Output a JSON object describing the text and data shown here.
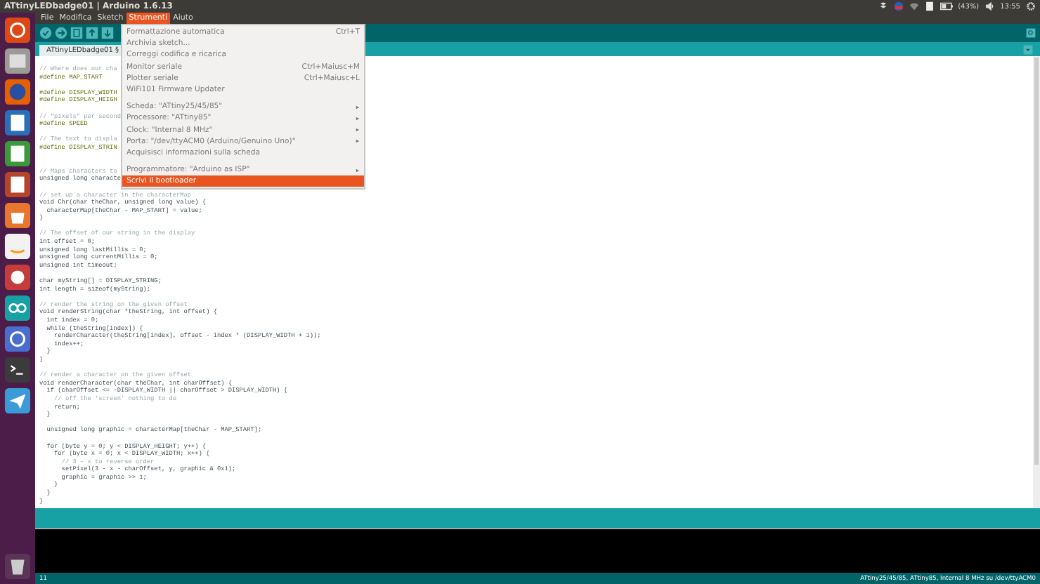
{
  "window": {
    "title": "ATtinyLEDbadge01 | Arduino 1.6.13"
  },
  "top_panel": {
    "battery": "(43%)",
    "clock": "13:55"
  },
  "menu_bar": [
    {
      "label": "File",
      "selected": false
    },
    {
      "label": "Modifica",
      "selected": false
    },
    {
      "label": "Sketch",
      "selected": false
    },
    {
      "label": "Strumenti",
      "selected": true
    },
    {
      "label": "Aiuto",
      "selected": false
    }
  ],
  "open_menu": {
    "items": [
      {
        "kind": "item",
        "label": "Formattazione automatica",
        "shortcut": "Ctrl+T",
        "selected": false
      },
      {
        "kind": "item",
        "label": "Archivia sketch...",
        "selected": false
      },
      {
        "kind": "item",
        "label": "Correggi codifica e ricarica",
        "selected": false
      },
      {
        "kind": "item",
        "label": "Monitor seriale",
        "shortcut": "Ctrl+Maiusc+M",
        "selected": false
      },
      {
        "kind": "item",
        "label": "Plotter seriale",
        "shortcut": "Ctrl+Maiusc+L",
        "selected": false
      },
      {
        "kind": "item",
        "label": "WiFi101 Firmware Updater",
        "selected": false
      },
      {
        "kind": "separator"
      },
      {
        "kind": "submenu",
        "label": "Scheda: \"ATtiny25/45/85\"",
        "selected": false
      },
      {
        "kind": "submenu",
        "label": "Processore: \"ATtiny85\"",
        "selected": false
      },
      {
        "kind": "submenu",
        "label": "Clock: \"Internal 8 MHz\"",
        "selected": false
      },
      {
        "kind": "submenu",
        "label": "Porta: \"/dev/ttyACM0 (Arduino/Genuino Uno)\"",
        "selected": false
      },
      {
        "kind": "item",
        "label": "Acquisisci informazioni sulla scheda",
        "selected": false
      },
      {
        "kind": "separator"
      },
      {
        "kind": "submenu",
        "label": "Programmatore: \"Arduino as ISP\"",
        "selected": false
      },
      {
        "kind": "item",
        "label": "Scrivi il bootloader",
        "selected": true
      }
    ]
  },
  "tabs": [
    {
      "label": "ATtinyLEDbadge01 §",
      "selected": true
    }
  ],
  "code": [
    {
      "kind": "comment",
      "text": "// Where does our cha"
    },
    {
      "kind": "directive",
      "text": "#define MAP_START"
    },
    {
      "kind": "blank"
    },
    {
      "kind": "directive",
      "text": "#define DISPLAY_WIDTH"
    },
    {
      "kind": "directive",
      "text": "#define DISPLAY_HEIGH"
    },
    {
      "kind": "blank"
    },
    {
      "kind": "comment",
      "text": "// \"pixels\" per second"
    },
    {
      "kind": "directive",
      "text": "#define SPEED"
    },
    {
      "kind": "blank"
    },
    {
      "kind": "comment",
      "text": "// The text to displa"
    },
    {
      "kind": "directive",
      "text": "#define DISPLAY_STRIN"
    },
    {
      "kind": "blank"
    },
    {
      "kind": "blank"
    },
    {
      "kind": "comment",
      "text": "// Maps characters to"
    },
    {
      "kind": "code",
      "text": "unsigned long characte"
    },
    {
      "kind": "blank"
    },
    {
      "kind": "comment",
      "text": "// set up a character in the characterMap"
    },
    {
      "kind": "code",
      "text": "void Chr(char theChar, unsigned long value) {"
    },
    {
      "kind": "code",
      "text": "  characterMap[theChar - MAP_START] = value;"
    },
    {
      "kind": "code",
      "text": "}"
    },
    {
      "kind": "blank"
    },
    {
      "kind": "comment",
      "text": "// The offset of our string in the display"
    },
    {
      "kind": "code",
      "text": "int offset = 0;"
    },
    {
      "kind": "code",
      "text": "unsigned long lastMillis = 0;"
    },
    {
      "kind": "code",
      "text": "unsigned long currentMillis = 0;"
    },
    {
      "kind": "code",
      "text": "unsigned int timeout;"
    },
    {
      "kind": "blank"
    },
    {
      "kind": "code",
      "text": "char myString[] = DISPLAY_STRING;"
    },
    {
      "kind": "code",
      "text": "int length = sizeof(myString);"
    },
    {
      "kind": "blank"
    },
    {
      "kind": "comment",
      "text": "// render the string on the given offset"
    },
    {
      "kind": "code",
      "text": "void renderString(char *theString, int offset) {"
    },
    {
      "kind": "code",
      "text": "  int index = 0;"
    },
    {
      "kind": "code",
      "text": "  while (theString[index]) {"
    },
    {
      "kind": "code",
      "text": "    renderCharacter(theString[index], offset - index * (DISPLAY_WIDTH + 1));"
    },
    {
      "kind": "code",
      "text": "    index++;"
    },
    {
      "kind": "code",
      "text": "  }"
    },
    {
      "kind": "code",
      "text": "}"
    },
    {
      "kind": "blank"
    },
    {
      "kind": "comment",
      "text": "// render a character on the given offset"
    },
    {
      "kind": "code",
      "text": "void renderCharacter(char theChar, int charOffset) {"
    },
    {
      "kind": "code",
      "text": "  if (charOffset <= -DISPLAY_WIDTH || charOffset > DISPLAY_WIDTH) {"
    },
    {
      "kind": "comment",
      "text": "    // off the 'screen' nothing to do"
    },
    {
      "kind": "code",
      "text": "    return;"
    },
    {
      "kind": "code",
      "text": "  }"
    },
    {
      "kind": "blank"
    },
    {
      "kind": "code",
      "text": "  unsigned long graphic = characterMap[theChar - MAP_START];"
    },
    {
      "kind": "blank"
    },
    {
      "kind": "code",
      "text": "  for (byte y = 0; y < DISPLAY_HEIGHT; y++) {"
    },
    {
      "kind": "code",
      "text": "    for (byte x = 0; x < DISPLAY_WIDTH; x++) {"
    },
    {
      "kind": "comment",
      "text": "      // 3 - x to reverse order"
    },
    {
      "kind": "code",
      "text": "      setPixel(3 - x - charOffset, y, graphic & 0x1);"
    },
    {
      "kind": "code",
      "text": "      graphic = graphic >> 1;"
    },
    {
      "kind": "code",
      "text": "    }"
    },
    {
      "kind": "code",
      "text": "  }"
    },
    {
      "kind": "code",
      "text": "}"
    }
  ],
  "status_bar": {
    "line": "11",
    "board": "ATtiny25/45/85, ATtiny85, Internal 8 MHz su /dev/ttyACM0"
  }
}
